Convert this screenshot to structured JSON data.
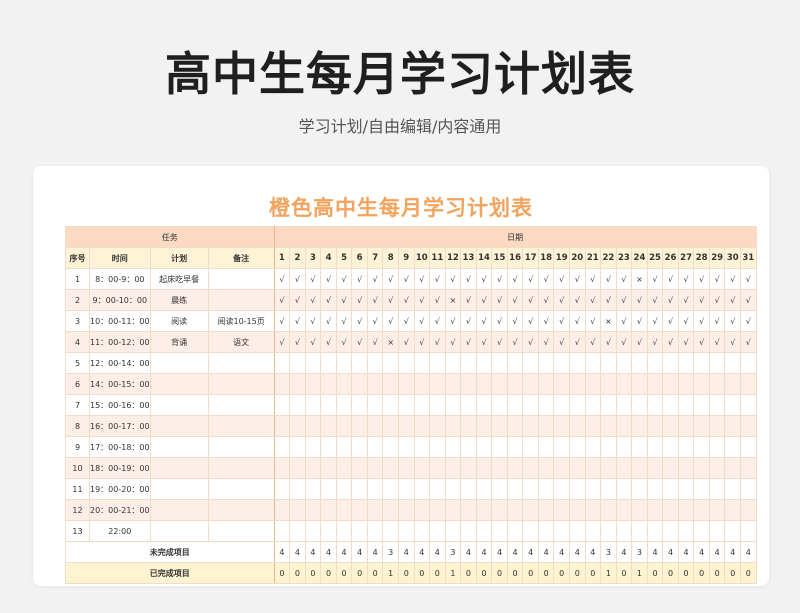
{
  "header": {
    "title": "高中生每月学习计划表",
    "subtitle": "学习计划/自由编辑/内容通用"
  },
  "sheet": {
    "title": "橙色高中生每月学习计划表",
    "group_task": "任务",
    "group_date": "日期",
    "col_seq": "序号",
    "col_time": "时间",
    "col_plan": "计划",
    "col_note": "备注",
    "days": [
      "1",
      "2",
      "3",
      "4",
      "5",
      "6",
      "7",
      "8",
      "9",
      "10",
      "11",
      "12",
      "13",
      "14",
      "15",
      "16",
      "17",
      "18",
      "19",
      "20",
      "21",
      "22",
      "23",
      "24",
      "25",
      "26",
      "27",
      "28",
      "29",
      "30",
      "31"
    ],
    "rows": [
      {
        "seq": "1",
        "time": "8：00-9：00",
        "plan": "起床吃早餐",
        "note": "",
        "marks": [
          "√",
          "√",
          "√",
          "√",
          "√",
          "√",
          "√",
          "√",
          "√",
          "√",
          "√",
          "√",
          "√",
          "√",
          "√",
          "√",
          "√",
          "√",
          "√",
          "√",
          "√",
          "√",
          "√",
          "×",
          "√",
          "√",
          "√",
          "√",
          "√",
          "√",
          "√"
        ]
      },
      {
        "seq": "2",
        "time": "9：00-10：00",
        "plan": "晨练",
        "note": "",
        "marks": [
          "√",
          "√",
          "√",
          "√",
          "√",
          "√",
          "√",
          "√",
          "√",
          "√",
          "√",
          "×",
          "√",
          "√",
          "√",
          "√",
          "√",
          "√",
          "√",
          "√",
          "√",
          "√",
          "√",
          "√",
          "√",
          "√",
          "√",
          "√",
          "√",
          "√",
          "√"
        ]
      },
      {
        "seq": "3",
        "time": "10：00-11：00",
        "plan": "阅读",
        "note": "阅读10-15页",
        "marks": [
          "√",
          "√",
          "√",
          "√",
          "√",
          "√",
          "√",
          "√",
          "√",
          "√",
          "√",
          "√",
          "√",
          "√",
          "√",
          "√",
          "√",
          "√",
          "√",
          "√",
          "√",
          "×",
          "√",
          "√",
          "√",
          "√",
          "√",
          "√",
          "√",
          "√",
          "√"
        ]
      },
      {
        "seq": "4",
        "time": "11：00-12：00",
        "plan": "背诵",
        "note": "语文",
        "marks": [
          "√",
          "√",
          "√",
          "√",
          "√",
          "√",
          "√",
          "×",
          "√",
          "√",
          "√",
          "√",
          "√",
          "√",
          "√",
          "√",
          "√",
          "√",
          "√",
          "√",
          "√",
          "√",
          "√",
          "√",
          "√",
          "√",
          "√",
          "√",
          "√",
          "√",
          "√"
        ]
      },
      {
        "seq": "5",
        "time": "12：00-14：00",
        "plan": "",
        "note": "",
        "marks": []
      },
      {
        "seq": "6",
        "time": "14：00-15：00",
        "plan": "",
        "note": "",
        "marks": []
      },
      {
        "seq": "7",
        "time": "15：00-16：00",
        "plan": "",
        "note": "",
        "marks": []
      },
      {
        "seq": "8",
        "time": "16：00-17：00",
        "plan": "",
        "note": "",
        "marks": []
      },
      {
        "seq": "9",
        "time": "17：00-18：00",
        "plan": "",
        "note": "",
        "marks": []
      },
      {
        "seq": "10",
        "time": "18：00-19：00",
        "plan": "",
        "note": "",
        "marks": []
      },
      {
        "seq": "11",
        "time": "19：00-20：00",
        "plan": "",
        "note": "",
        "marks": []
      },
      {
        "seq": "12",
        "time": "20：00-21：00",
        "plan": "",
        "note": "",
        "marks": []
      },
      {
        "seq": "13",
        "time": "22:00",
        "plan": "",
        "note": "",
        "marks": []
      }
    ],
    "unfinished_label": "未完成项目",
    "unfinished": [
      "4",
      "4",
      "4",
      "4",
      "4",
      "4",
      "4",
      "3",
      "4",
      "4",
      "4",
      "3",
      "4",
      "4",
      "4",
      "4",
      "4",
      "4",
      "4",
      "4",
      "4",
      "3",
      "4",
      "3",
      "4",
      "4",
      "4",
      "4",
      "4",
      "4",
      "4"
    ],
    "finished_label": "已完成项目",
    "finished": [
      "0",
      "0",
      "0",
      "0",
      "0",
      "0",
      "0",
      "1",
      "0",
      "0",
      "0",
      "1",
      "0",
      "0",
      "0",
      "0",
      "0",
      "0",
      "0",
      "0",
      "0",
      "1",
      "0",
      "1",
      "0",
      "0",
      "0",
      "0",
      "0",
      "0",
      "0"
    ]
  }
}
